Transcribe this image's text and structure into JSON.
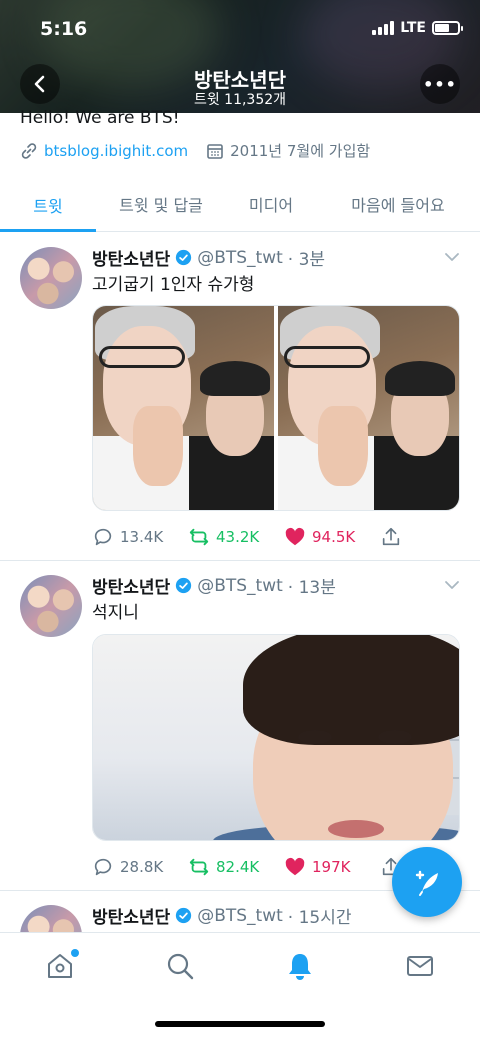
{
  "status_bar": {
    "time": "5:16",
    "network": "LTE"
  },
  "header": {
    "title": "방탄소년단",
    "subtitle": "트윗 11,352개",
    "more_label": "•••"
  },
  "profile": {
    "bio": "Hello! We are BTS!",
    "website": "btsblog.ibighit.com",
    "joined": "2011년 7월에 가입함"
  },
  "tabs": [
    {
      "label": "트윗",
      "active": true
    },
    {
      "label": "트윗 및 답글",
      "active": false
    },
    {
      "label": "미디어",
      "active": false
    },
    {
      "label": "마음에 들어요",
      "active": false
    }
  ],
  "tweets": [
    {
      "name": "방탄소년단",
      "handle": "@BTS_twt",
      "time": "· 3분",
      "text": "고기굽기 1인자 슈가형",
      "replies": "13.4K",
      "retweets": "43.2K",
      "likes": "94.5K"
    },
    {
      "name": "방탄소년단",
      "handle": "@BTS_twt",
      "time": "· 13분",
      "text": "석지니",
      "replies": "28.8K",
      "retweets": "82.4K",
      "likes": "197K"
    },
    {
      "name": "방탄소년단",
      "handle": "@BTS_twt",
      "time": "· 15시간",
      "text": ""
    }
  ],
  "colors": {
    "accent": "#1da1f2",
    "retweet": "#17bf63",
    "like": "#e0245e",
    "muted": "#657786"
  },
  "icons": [
    "back-arrow-icon",
    "more-icon",
    "link-icon",
    "calendar-icon",
    "verified-icon",
    "caret-down-icon",
    "reply-icon",
    "retweet-icon",
    "heart-icon",
    "share-icon",
    "compose-icon",
    "home-icon",
    "search-icon",
    "notifications-icon",
    "messages-icon"
  ]
}
